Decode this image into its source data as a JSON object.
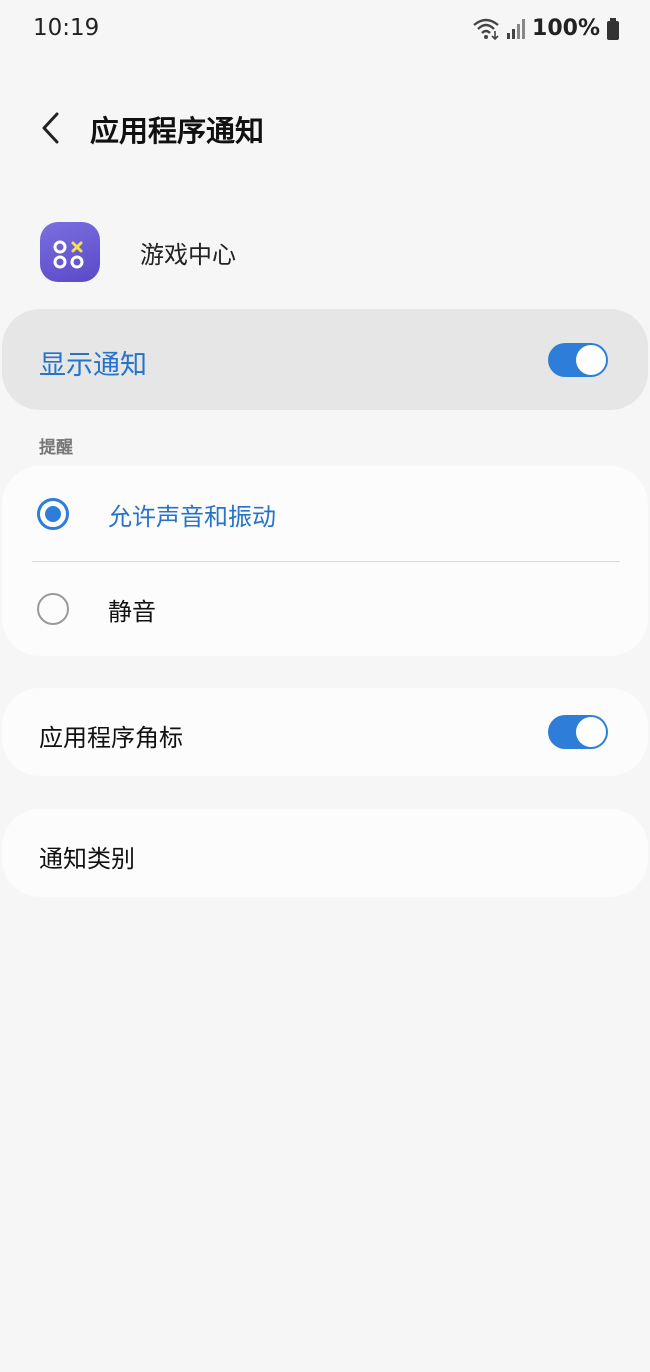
{
  "status_bar": {
    "time": "10:19",
    "battery_percent": "100%",
    "icons": [
      "wifi-icon",
      "signal-icon",
      "battery-icon"
    ]
  },
  "header": {
    "title": "应用程序通知",
    "back_icon": "chevron-left-icon"
  },
  "app": {
    "name": "游戏中心",
    "icon": "game-center-icon"
  },
  "show_notifications": {
    "label": "显示通知",
    "enabled": true
  },
  "alert_section": {
    "label": "提醒",
    "options": [
      {
        "label": "允许声音和振动",
        "selected": true
      },
      {
        "label": "静音",
        "selected": false
      }
    ]
  },
  "app_badge": {
    "label": "应用程序角标",
    "enabled": true
  },
  "notification_categories": {
    "label": "通知类别"
  },
  "colors": {
    "accent": "#2e7ed9",
    "accent_text": "#2673c9",
    "background": "#f6f6f6",
    "card": "#fcfcfc",
    "highlight_card": "#e6e6e6",
    "app_icon": "#6a5bd6"
  }
}
